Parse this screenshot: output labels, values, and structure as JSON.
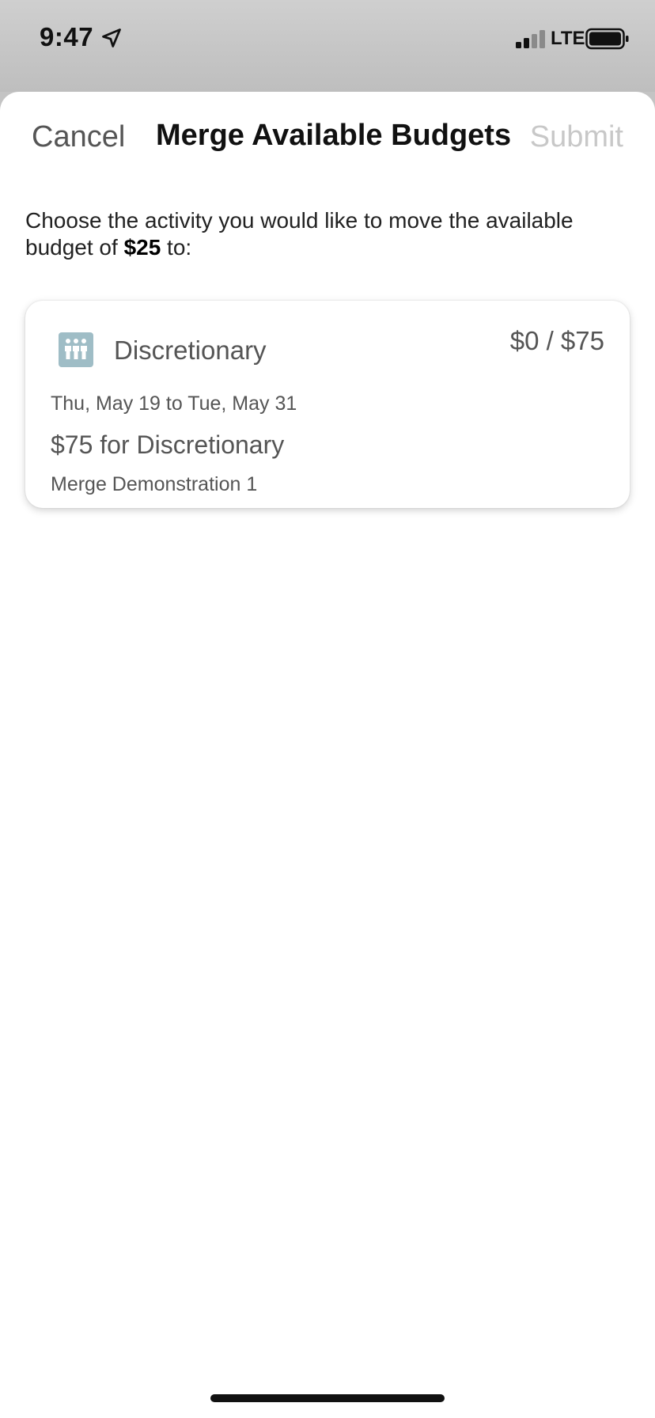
{
  "status_bar": {
    "time": "9:47",
    "network": "LTE",
    "icons": [
      "location-arrow-icon",
      "signal-icon",
      "battery-icon"
    ]
  },
  "nav": {
    "cancel_label": "Cancel",
    "title": "Merge Available Budgets",
    "submit_label": "Submit"
  },
  "instruction": {
    "prefix": "Choose the activity you would like to move the available budget of ",
    "amount": "$25",
    "suffix": " to:"
  },
  "activities": [
    {
      "icon": "people-group-icon",
      "name": "Discretionary",
      "amount": "$0 / $75",
      "dates": "Thu, May 19 to Tue, May 31",
      "description": "$75 for Discretionary",
      "plan": "Merge Demonstration 1"
    }
  ],
  "colors": {
    "icon_bg": "#9fbdc6",
    "submit_disabled": "#c8c8c8",
    "text_secondary": "#555555"
  }
}
